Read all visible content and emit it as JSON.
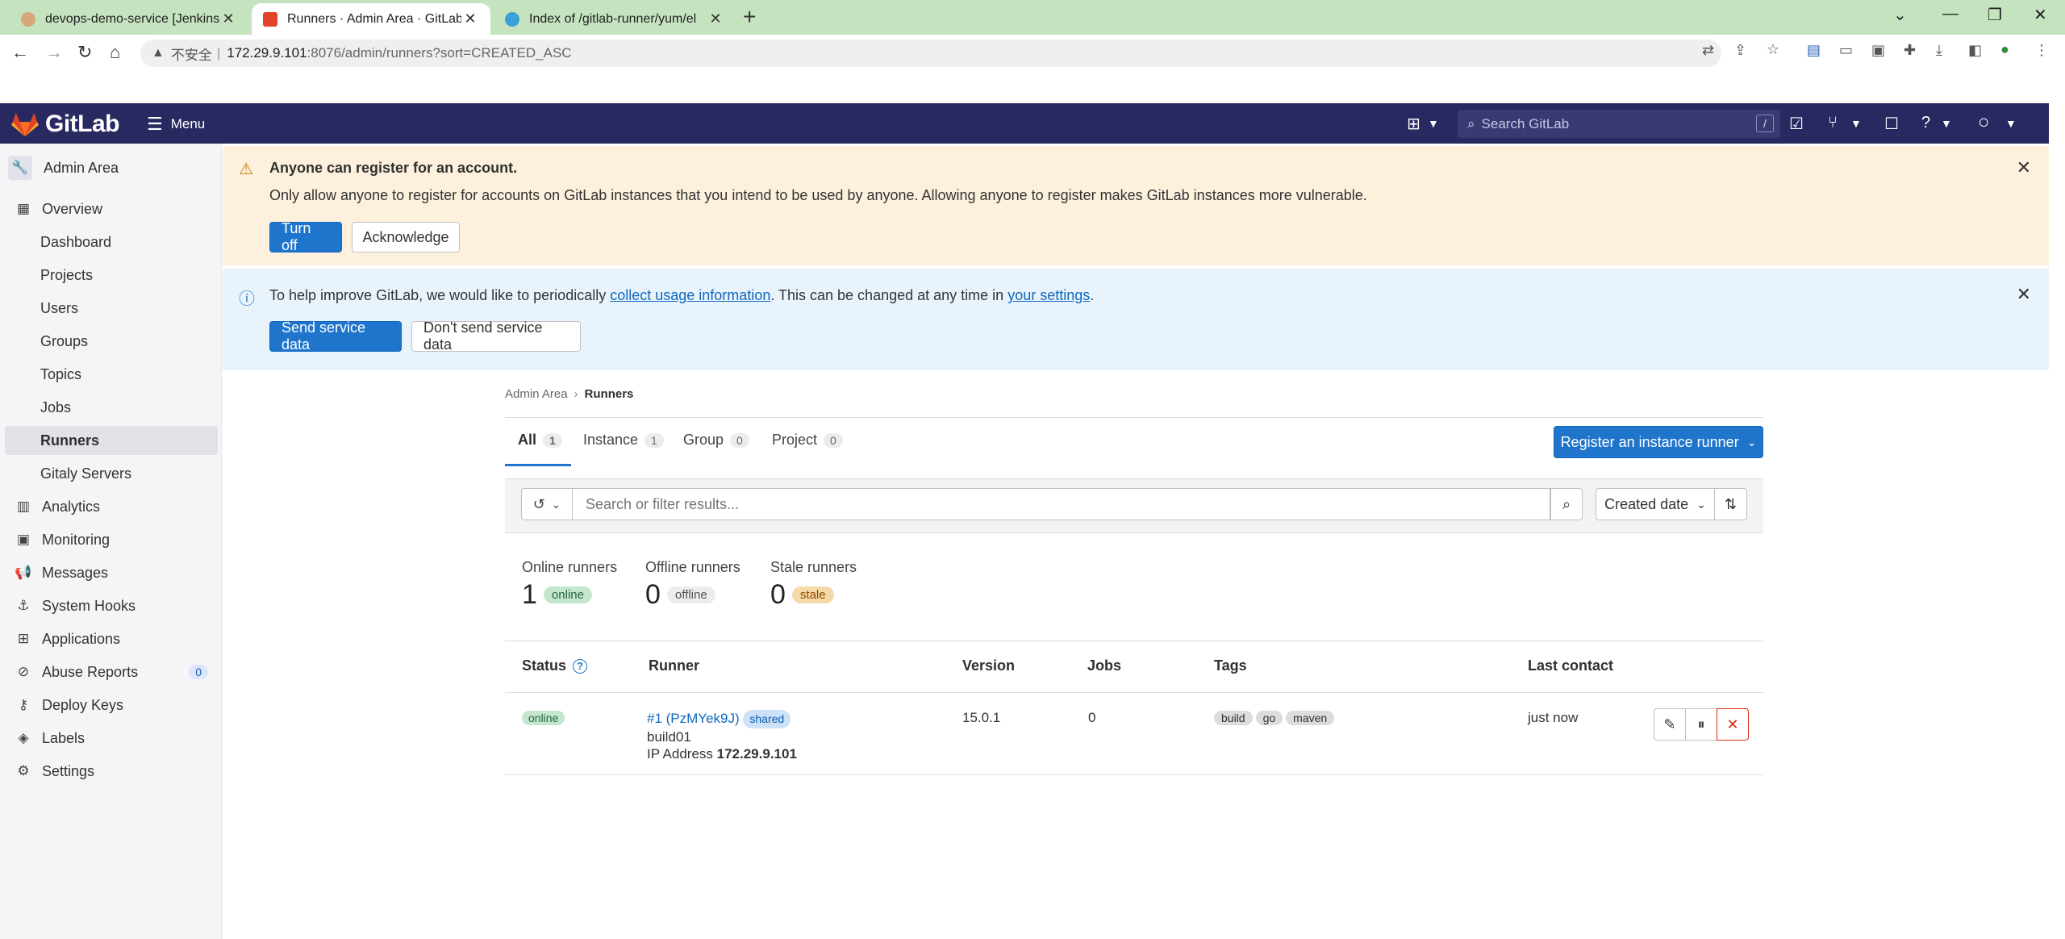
{
  "browser": {
    "tabs": [
      {
        "title": "devops-demo-service [Jenkins]"
      },
      {
        "title": "Runners · Admin Area · GitLab"
      },
      {
        "title": "Index of /gitlab-runner/yum/el"
      }
    ],
    "address": {
      "insecure": "不安全",
      "host": "172.29.9.101",
      "path": ":8076/admin/runners?sort=CREATED_ASC"
    }
  },
  "header": {
    "brand": "GitLab",
    "menu_label": "Menu",
    "search_placeholder": "Search GitLab",
    "search_shortcut": "/"
  },
  "sidebar": {
    "context_title": "Admin Area",
    "items": [
      {
        "label": "Overview",
        "icon": "overview-icon"
      },
      {
        "label": "Dashboard"
      },
      {
        "label": "Projects"
      },
      {
        "label": "Users"
      },
      {
        "label": "Groups"
      },
      {
        "label": "Topics"
      },
      {
        "label": "Jobs"
      },
      {
        "label": "Runners"
      },
      {
        "label": "Gitaly Servers"
      },
      {
        "label": "Analytics",
        "icon": "analytics-icon"
      },
      {
        "label": "Monitoring",
        "icon": "monitor-icon"
      },
      {
        "label": "Messages",
        "icon": "bullhorn-icon"
      },
      {
        "label": "System Hooks",
        "icon": "hook-icon"
      },
      {
        "label": "Applications",
        "icon": "applications-icon"
      },
      {
        "label": "Abuse Reports",
        "icon": "abuse-icon",
        "count": "0"
      },
      {
        "label": "Deploy Keys",
        "icon": "key-icon"
      },
      {
        "label": "Labels",
        "icon": "label-icon"
      },
      {
        "label": "Settings",
        "icon": "settings-icon"
      }
    ]
  },
  "alerts": {
    "signup": {
      "title": "Anyone can register for an account.",
      "body": "Only allow anyone to register for accounts on GitLab instances that you intend to be used by anyone. Allowing anyone to register makes GitLab instances more vulnerable.",
      "primary": "Turn off",
      "secondary": "Acknowledge"
    },
    "usage": {
      "text_before": "To help improve GitLab, we would like to periodically ",
      "link1": "collect usage information",
      "text_mid": ". This can be changed at any time in ",
      "link2": "your settings",
      "text_after": ".",
      "primary": "Send service data",
      "secondary": "Don't send service data"
    }
  },
  "breadcrumb": {
    "parent": "Admin Area",
    "current": "Runners"
  },
  "tabs": [
    {
      "label": "All",
      "count": "1"
    },
    {
      "label": "Instance",
      "count": "1"
    },
    {
      "label": "Group",
      "count": "0"
    },
    {
      "label": "Project",
      "count": "0"
    }
  ],
  "register_button": "Register an instance runner",
  "filter": {
    "placeholder": "Search or filter results...",
    "sort_label": "Created date"
  },
  "stats": [
    {
      "label": "Online runners",
      "value": "1",
      "badge": "online"
    },
    {
      "label": "Offline runners",
      "value": "0",
      "badge": "offline"
    },
    {
      "label": "Stale runners",
      "value": "0",
      "badge": "stale"
    }
  ],
  "table": {
    "columns": [
      "Status",
      "Runner",
      "Version",
      "Jobs",
      "Tags",
      "Last contact"
    ],
    "rows": [
      {
        "status": "online",
        "runner_id": "#1 (PzMYek9J)",
        "runner_type": "shared",
        "description": "build01",
        "ip_label": "IP Address",
        "ip": "172.29.9.101",
        "version": "15.0.1",
        "jobs": "0",
        "tags": [
          "build",
          "go",
          "maven"
        ],
        "last_contact": "just now"
      }
    ]
  },
  "colors": {
    "header": "#292961",
    "primary": "#1f75cb",
    "warning_bg": "#fdf1dd",
    "info_bg": "#e9f3fc",
    "danger": "#dd2b0e"
  }
}
